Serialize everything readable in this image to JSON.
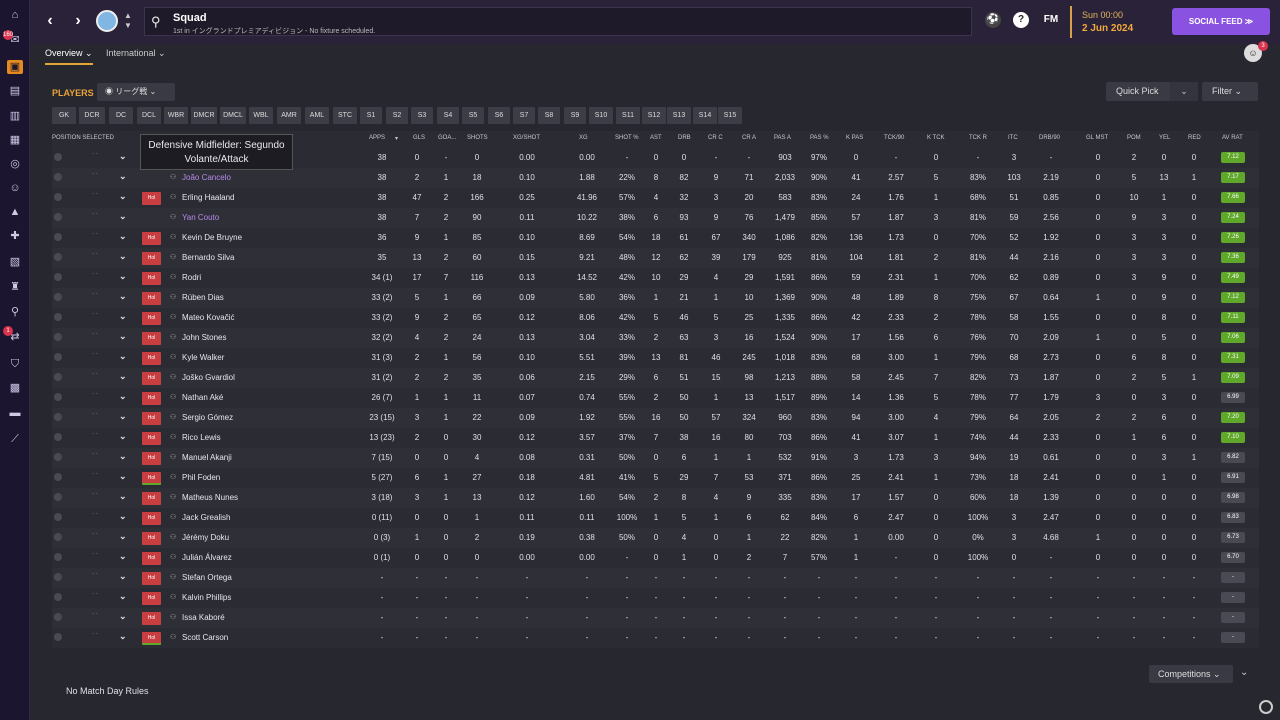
{
  "sidebar": {
    "icons": [
      "home-icon",
      "inbox-icon",
      "squad-icon",
      "tactics-icon",
      "data-hub-icon",
      "training-icon",
      "dynamics-icon",
      "staff-icon",
      "scouting-icon",
      "medical-icon",
      "schedule-icon",
      "competitions-icon",
      "search-icon",
      "transfers-icon",
      "club-info-icon",
      "finances-icon",
      "dev-centre-icon",
      "report-icon"
    ],
    "inbox_badge": "160",
    "transfers_badge": "1"
  },
  "header": {
    "title": "Squad",
    "subtitle": "1st in イングランドプレミアディビジョン - No fixture scheduled.",
    "fm_label": "FM",
    "time": "Sun 00:00",
    "date": "2 Jun 2024",
    "social_feed": "SOCIAL FEED",
    "staff_badge": "3"
  },
  "tabs": {
    "overview": "Overview",
    "international": "International"
  },
  "toolbar": {
    "players_label": "PLAYERS",
    "view_select": "リーグ戦",
    "quick_pick": "Quick Pick",
    "filter": "Filter",
    "positions": [
      "GK",
      "DCR",
      "DC",
      "DCL",
      "WBR",
      "DMCR",
      "DMCL",
      "WBL",
      "AMR",
      "AML",
      "STC",
      "S1",
      "S2",
      "S3",
      "S4",
      "S5",
      "S6",
      "S7",
      "S8",
      "S9",
      "S10",
      "S11",
      "S12",
      "S13",
      "S14",
      "S15"
    ]
  },
  "tooltip": {
    "line1": "Defensive Midfielder: Segundo",
    "line2": "Volante/Attack"
  },
  "table": {
    "headers": [
      "POSITION SELECTED",
      "APPS",
      "GLS",
      "GOA...",
      "SHOTS",
      "XG/SHOT",
      "XG",
      "SHOT %",
      "AST",
      "DRB",
      "CR C",
      "CR A",
      "PAS A",
      "PAS %",
      "K PAS",
      "TCK/90",
      "K TCK",
      "TCK R",
      "ITC",
      "DRB/90",
      "GL MST",
      "POM",
      "YEL",
      "RED",
      "AV RAT"
    ],
    "rows": [
      {
        "name": "",
        "role": "",
        "apps": "38",
        "gls": "0",
        "goa": "-",
        "shots": "0",
        "xgs": "0.00",
        "xg": "0.00",
        "shotp": "-",
        "ast": "0",
        "drb": "0",
        "crc": "-",
        "cra": "-",
        "pasa": "903",
        "pasp": "97%",
        "kpas": "0",
        "tck90": "-",
        "ktck": "0",
        "tckr": "-",
        "itc": "3",
        "drb90": "-",
        "glmst": "0",
        "pom": "2",
        "yel": "0",
        "red": "0",
        "rat": "7.12"
      },
      {
        "name": "João Cancelo",
        "role": "",
        "apps": "38",
        "gls": "2",
        "goa": "1",
        "shots": "18",
        "xgs": "0.10",
        "xg": "1.88",
        "shotp": "22%",
        "ast": "8",
        "drb": "82",
        "crc": "9",
        "cra": "71",
        "pasa": "2,033",
        "pasp": "90%",
        "kpas": "41",
        "tck90": "2.57",
        "ktck": "5",
        "tckr": "83%",
        "itc": "103",
        "drb90": "2.19",
        "glmst": "0",
        "pom": "5",
        "yel": "13",
        "red": "1",
        "rat": "7.17"
      },
      {
        "name": "Erling Haaland",
        "role": "Hol",
        "apps": "38",
        "gls": "47",
        "goa": "2",
        "shots": "166",
        "xgs": "0.25",
        "xg": "41.96",
        "shotp": "57%",
        "ast": "4",
        "drb": "32",
        "crc": "3",
        "cra": "20",
        "pasa": "583",
        "pasp": "83%",
        "kpas": "24",
        "tck90": "1.76",
        "ktck": "1",
        "tckr": "68%",
        "itc": "51",
        "drb90": "0.85",
        "glmst": "0",
        "pom": "10",
        "yel": "1",
        "red": "0",
        "rat": "7.66"
      },
      {
        "name": "Yan Couto",
        "role": "",
        "apps": "38",
        "gls": "7",
        "goa": "2",
        "shots": "90",
        "xgs": "0.11",
        "xg": "10.22",
        "shotp": "38%",
        "ast": "6",
        "drb": "93",
        "crc": "9",
        "cra": "76",
        "pasa": "1,479",
        "pasp": "85%",
        "kpas": "57",
        "tck90": "1.87",
        "ktck": "3",
        "tckr": "81%",
        "itc": "59",
        "drb90": "2.56",
        "glmst": "0",
        "pom": "9",
        "yel": "3",
        "red": "0",
        "rat": "7.24"
      },
      {
        "name": "Kevin De Bruyne",
        "role": "Hol",
        "apps": "36",
        "gls": "9",
        "goa": "1",
        "shots": "85",
        "xgs": "0.10",
        "xg": "8.69",
        "shotp": "54%",
        "ast": "18",
        "drb": "61",
        "crc": "67",
        "cra": "340",
        "pasa": "1,086",
        "pasp": "82%",
        "kpas": "136",
        "tck90": "1.73",
        "ktck": "0",
        "tckr": "70%",
        "itc": "52",
        "drb90": "1.92",
        "glmst": "0",
        "pom": "3",
        "yel": "3",
        "red": "0",
        "rat": "7.26"
      },
      {
        "name": "Bernardo Silva",
        "role": "Hol",
        "apps": "35",
        "gls": "13",
        "goa": "2",
        "shots": "60",
        "xgs": "0.15",
        "xg": "9.21",
        "shotp": "48%",
        "ast": "12",
        "drb": "62",
        "crc": "39",
        "cra": "179",
        "pasa": "925",
        "pasp": "81%",
        "kpas": "104",
        "tck90": "1.81",
        "ktck": "2",
        "tckr": "81%",
        "itc": "44",
        "drb90": "2.16",
        "glmst": "0",
        "pom": "3",
        "yel": "3",
        "red": "0",
        "rat": "7.36"
      },
      {
        "name": "Rodri",
        "role": "Hol",
        "apps": "34 (1)",
        "gls": "17",
        "goa": "7",
        "shots": "116",
        "xgs": "0.13",
        "xg": "14.52",
        "shotp": "42%",
        "ast": "10",
        "drb": "29",
        "crc": "4",
        "cra": "29",
        "pasa": "1,591",
        "pasp": "86%",
        "kpas": "59",
        "tck90": "2.31",
        "ktck": "1",
        "tckr": "70%",
        "itc": "62",
        "drb90": "0.89",
        "glmst": "0",
        "pom": "3",
        "yel": "9",
        "red": "0",
        "rat": "7.49"
      },
      {
        "name": "Rúben Dias",
        "role": "Hol",
        "apps": "33 (2)",
        "gls": "5",
        "goa": "1",
        "shots": "66",
        "xgs": "0.09",
        "xg": "5.80",
        "shotp": "36%",
        "ast": "1",
        "drb": "21",
        "crc": "1",
        "cra": "10",
        "pasa": "1,369",
        "pasp": "90%",
        "kpas": "48",
        "tck90": "1.89",
        "ktck": "8",
        "tckr": "75%",
        "itc": "67",
        "drb90": "0.64",
        "glmst": "1",
        "pom": "0",
        "yel": "9",
        "red": "0",
        "rat": "7.12"
      },
      {
        "name": "Mateo Kovačić",
        "role": "Hol",
        "apps": "33 (2)",
        "gls": "9",
        "goa": "2",
        "shots": "65",
        "xgs": "0.12",
        "xg": "8.06",
        "shotp": "42%",
        "ast": "5",
        "drb": "46",
        "crc": "5",
        "cra": "25",
        "pasa": "1,335",
        "pasp": "86%",
        "kpas": "42",
        "tck90": "2.33",
        "ktck": "2",
        "tckr": "78%",
        "itc": "58",
        "drb90": "1.55",
        "glmst": "0",
        "pom": "0",
        "yel": "8",
        "red": "0",
        "rat": "7.11"
      },
      {
        "name": "John Stones",
        "role": "Hol",
        "apps": "32 (2)",
        "gls": "4",
        "goa": "2",
        "shots": "24",
        "xgs": "0.13",
        "xg": "3.04",
        "shotp": "33%",
        "ast": "2",
        "drb": "63",
        "crc": "3",
        "cra": "16",
        "pasa": "1,524",
        "pasp": "90%",
        "kpas": "17",
        "tck90": "1.56",
        "ktck": "6",
        "tckr": "76%",
        "itc": "70",
        "drb90": "2.09",
        "glmst": "1",
        "pom": "0",
        "yel": "5",
        "red": "0",
        "rat": "7.06"
      },
      {
        "name": "Kyle Walker",
        "role": "Hol",
        "apps": "31 (3)",
        "gls": "2",
        "goa": "1",
        "shots": "56",
        "xgs": "0.10",
        "xg": "5.51",
        "shotp": "39%",
        "ast": "13",
        "drb": "81",
        "crc": "46",
        "cra": "245",
        "pasa": "1,018",
        "pasp": "83%",
        "kpas": "68",
        "tck90": "3.00",
        "ktck": "1",
        "tckr": "79%",
        "itc": "68",
        "drb90": "2.73",
        "glmst": "0",
        "pom": "6",
        "yel": "8",
        "red": "0",
        "rat": "7.31"
      },
      {
        "name": "Joško Gvardiol",
        "role": "Hol",
        "apps": "31 (2)",
        "gls": "2",
        "goa": "2",
        "shots": "35",
        "xgs": "0.06",
        "xg": "2.15",
        "shotp": "29%",
        "ast": "6",
        "drb": "51",
        "crc": "15",
        "cra": "98",
        "pasa": "1,213",
        "pasp": "88%",
        "kpas": "58",
        "tck90": "2.45",
        "ktck": "7",
        "tckr": "82%",
        "itc": "73",
        "drb90": "1.87",
        "glmst": "0",
        "pom": "2",
        "yel": "5",
        "red": "1",
        "rat": "7.09"
      },
      {
        "name": "Nathan Aké",
        "role": "Hol",
        "apps": "26 (7)",
        "gls": "1",
        "goa": "1",
        "shots": "11",
        "xgs": "0.07",
        "xg": "0.74",
        "shotp": "55%",
        "ast": "2",
        "drb": "50",
        "crc": "1",
        "cra": "13",
        "pasa": "1,517",
        "pasp": "89%",
        "kpas": "14",
        "tck90": "1.36",
        "ktck": "5",
        "tckr": "78%",
        "itc": "77",
        "drb90": "1.79",
        "glmst": "3",
        "pom": "0",
        "yel": "3",
        "red": "0",
        "rat": "6.99"
      },
      {
        "name": "Sergio Gómez",
        "role": "Hol",
        "apps": "23 (15)",
        "gls": "3",
        "goa": "1",
        "shots": "22",
        "xgs": "0.09",
        "xg": "1.92",
        "shotp": "55%",
        "ast": "16",
        "drb": "50",
        "crc": "57",
        "cra": "324",
        "pasa": "960",
        "pasp": "83%",
        "kpas": "94",
        "tck90": "3.00",
        "ktck": "4",
        "tckr": "79%",
        "itc": "64",
        "drb90": "2.05",
        "glmst": "2",
        "pom": "2",
        "yel": "6",
        "red": "0",
        "rat": "7.20"
      },
      {
        "name": "Rico Lewis",
        "role": "Hol",
        "apps": "13 (23)",
        "gls": "2",
        "goa": "0",
        "shots": "30",
        "xgs": "0.12",
        "xg": "3.57",
        "shotp": "37%",
        "ast": "7",
        "drb": "38",
        "crc": "16",
        "cra": "80",
        "pasa": "703",
        "pasp": "86%",
        "kpas": "41",
        "tck90": "3.07",
        "ktck": "1",
        "tckr": "74%",
        "itc": "44",
        "drb90": "2.33",
        "glmst": "0",
        "pom": "1",
        "yel": "6",
        "red": "0",
        "rat": "7.10"
      },
      {
        "name": "Manuel Akanji",
        "role": "Hol",
        "apps": "7 (15)",
        "gls": "0",
        "goa": "0",
        "shots": "4",
        "xgs": "0.08",
        "xg": "0.31",
        "shotp": "50%",
        "ast": "0",
        "drb": "6",
        "crc": "1",
        "cra": "1",
        "pasa": "532",
        "pasp": "91%",
        "kpas": "3",
        "tck90": "1.73",
        "ktck": "3",
        "tckr": "94%",
        "itc": "19",
        "drb90": "0.61",
        "glmst": "0",
        "pom": "0",
        "yel": "3",
        "red": "1",
        "rat": "6.82"
      },
      {
        "name": "Phil Foden",
        "role": "Hol",
        "apps": "5 (27)",
        "gls": "6",
        "goa": "1",
        "shots": "27",
        "xgs": "0.18",
        "xg": "4.81",
        "shotp": "41%",
        "ast": "5",
        "drb": "29",
        "crc": "7",
        "cra": "53",
        "pasa": "371",
        "pasp": "86%",
        "kpas": "25",
        "tck90": "2.41",
        "ktck": "1",
        "tckr": "73%",
        "itc": "18",
        "drb90": "2.41",
        "glmst": "0",
        "pom": "0",
        "yel": "1",
        "red": "0",
        "rat": "6.91"
      },
      {
        "name": "Matheus Nunes",
        "role": "Hol",
        "apps": "3 (18)",
        "gls": "3",
        "goa": "1",
        "shots": "13",
        "xgs": "0.12",
        "xg": "1.60",
        "shotp": "54%",
        "ast": "2",
        "drb": "8",
        "crc": "4",
        "cra": "9",
        "pasa": "335",
        "pasp": "83%",
        "kpas": "17",
        "tck90": "1.57",
        "ktck": "0",
        "tckr": "60%",
        "itc": "18",
        "drb90": "1.39",
        "glmst": "0",
        "pom": "0",
        "yel": "0",
        "red": "0",
        "rat": "6.98"
      },
      {
        "name": "Jack Grealish",
        "role": "Hol",
        "apps": "0 (11)",
        "gls": "0",
        "goa": "0",
        "shots": "1",
        "xgs": "0.11",
        "xg": "0.11",
        "shotp": "100%",
        "ast": "1",
        "drb": "5",
        "crc": "1",
        "cra": "6",
        "pasa": "62",
        "pasp": "84%",
        "kpas": "6",
        "tck90": "2.47",
        "ktck": "0",
        "tckr": "100%",
        "itc": "3",
        "drb90": "2.47",
        "glmst": "0",
        "pom": "0",
        "yel": "0",
        "red": "0",
        "rat": "6.83"
      },
      {
        "name": "Jérémy Doku",
        "role": "Hol",
        "apps": "0 (3)",
        "gls": "1",
        "goa": "0",
        "shots": "2",
        "xgs": "0.19",
        "xg": "0.38",
        "shotp": "50%",
        "ast": "0",
        "drb": "4",
        "crc": "0",
        "cra": "1",
        "pasa": "22",
        "pasp": "82%",
        "kpas": "1",
        "tck90": "0.00",
        "ktck": "0",
        "tckr": "0%",
        "itc": "3",
        "drb90": "4.68",
        "glmst": "1",
        "pom": "0",
        "yel": "0",
        "red": "0",
        "rat": "6.73"
      },
      {
        "name": "Julián Álvarez",
        "role": "Hol",
        "apps": "0 (1)",
        "gls": "0",
        "goa": "0",
        "shots": "0",
        "xgs": "0.00",
        "xg": "0.00",
        "shotp": "-",
        "ast": "0",
        "drb": "1",
        "crc": "0",
        "cra": "2",
        "pasa": "7",
        "pasp": "57%",
        "kpas": "1",
        "tck90": "-",
        "ktck": "0",
        "tckr": "100%",
        "itc": "0",
        "drb90": "-",
        "glmst": "0",
        "pom": "0",
        "yel": "0",
        "red": "0",
        "rat": "6.70"
      },
      {
        "name": "Stefan Ortega",
        "role": "Hol",
        "apps": "-",
        "gls": "-",
        "goa": "-",
        "shots": "-",
        "xgs": "-",
        "xg": "-",
        "shotp": "-",
        "ast": "-",
        "drb": "-",
        "crc": "-",
        "cra": "-",
        "pasa": "-",
        "pasp": "-",
        "kpas": "-",
        "tck90": "-",
        "ktck": "-",
        "tckr": "-",
        "itc": "-",
        "drb90": "-",
        "glmst": "-",
        "pom": "-",
        "yel": "-",
        "red": "-",
        "rat": "-"
      },
      {
        "name": "Kalvin Phillips",
        "role": "Hol",
        "apps": "-",
        "gls": "-",
        "goa": "-",
        "shots": "-",
        "xgs": "-",
        "xg": "-",
        "shotp": "-",
        "ast": "-",
        "drb": "-",
        "crc": "-",
        "cra": "-",
        "pasa": "-",
        "pasp": "-",
        "kpas": "-",
        "tck90": "-",
        "ktck": "-",
        "tckr": "-",
        "itc": "-",
        "drb90": "-",
        "glmst": "-",
        "pom": "-",
        "yel": "-",
        "red": "-",
        "rat": "-"
      },
      {
        "name": "Issa Kaboré",
        "role": "Hol",
        "apps": "-",
        "gls": "-",
        "goa": "-",
        "shots": "-",
        "xgs": "-",
        "xg": "-",
        "shotp": "-",
        "ast": "-",
        "drb": "-",
        "crc": "-",
        "cra": "-",
        "pasa": "-",
        "pasp": "-",
        "kpas": "-",
        "tck90": "-",
        "ktck": "-",
        "tckr": "-",
        "itc": "-",
        "drb90": "-",
        "glmst": "-",
        "pom": "-",
        "yel": "-",
        "red": "-",
        "rat": "-"
      },
      {
        "name": "Scott Carson",
        "role": "Hol",
        "apps": "-",
        "gls": "-",
        "goa": "-",
        "shots": "-",
        "xgs": "-",
        "xg": "-",
        "shotp": "-",
        "ast": "-",
        "drb": "-",
        "crc": "-",
        "cra": "-",
        "pasa": "-",
        "pasp": "-",
        "kpas": "-",
        "tck90": "-",
        "ktck": "-",
        "tckr": "-",
        "itc": "-",
        "drb90": "-",
        "glmst": "-",
        "pom": "-",
        "yel": "-",
        "red": "-",
        "rat": "-"
      }
    ]
  },
  "footer": {
    "competitions": "Competitions",
    "no_rules": "No Match Day Rules"
  },
  "colors": {
    "accent": "#e8a33a",
    "social": "#8a52e0",
    "role_red": "#c93f41",
    "rating_green": "#5fa82a",
    "rating_grey": "#4a4a54"
  }
}
